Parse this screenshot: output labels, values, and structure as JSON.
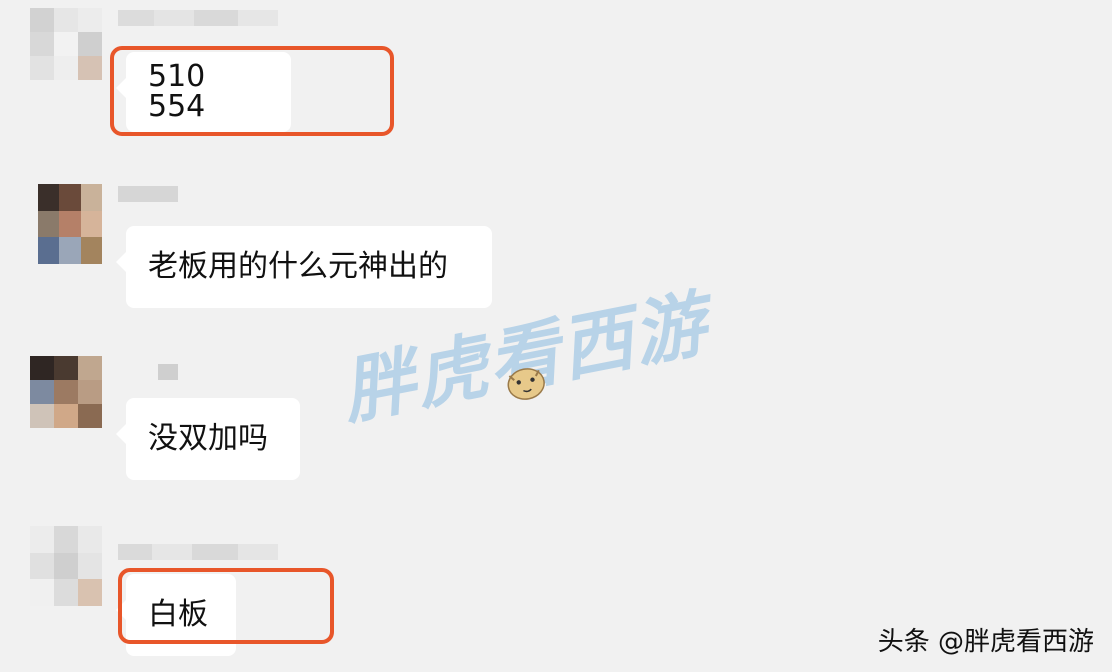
{
  "messages": [
    {
      "text": "510 554",
      "highlighted": true
    },
    {
      "text": "老板用的什么元神出的",
      "highlighted": false
    },
    {
      "text": "没双加吗",
      "highlighted": false
    },
    {
      "text": "白板",
      "highlighted": true
    }
  ],
  "watermark": {
    "text": "胖虎看西游",
    "color": "#69aadc"
  },
  "footer": {
    "credit": "头条 @胖虎看西游"
  },
  "colors": {
    "background": "#f1f1f1",
    "bubble": "#ffffff",
    "highlight": "#e8562a"
  }
}
